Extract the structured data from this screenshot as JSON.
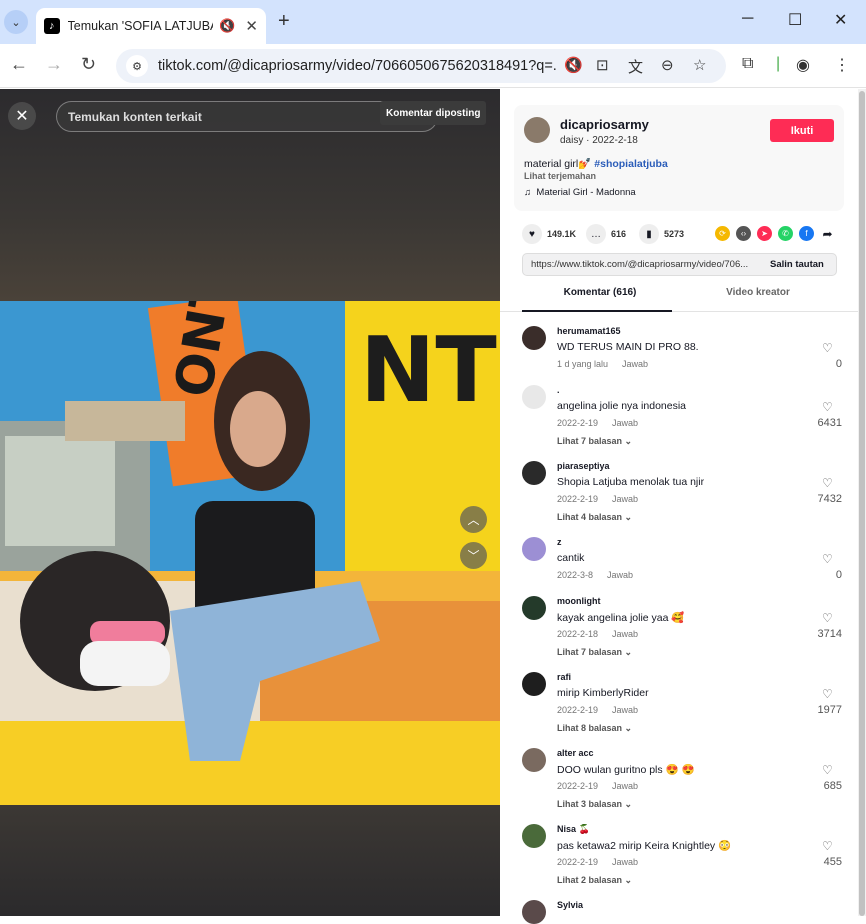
{
  "browser": {
    "tab_title": "Temukan 'SOFIA LATJUBA' di",
    "url": "tiktok.com/@dicapriosarmy/video/7066050675620318491?q=..."
  },
  "video": {
    "search_placeholder": "Temukan konten terkait",
    "tooltip": "Komentar diposting",
    "frame_text_left": "ONT",
    "frame_text_right": "NT"
  },
  "post": {
    "username": "dicapriosarmy",
    "nickname": "daisy",
    "date": "2022-2-18",
    "follow_label": "Ikuti",
    "caption": "material girl💅",
    "hashtag": "#shopialatjuba",
    "translate_label": "Lihat terjemahan",
    "music": "Material Girl - Madonna",
    "likes": "149.1K",
    "comments": "616",
    "saves": "5273",
    "link": "https://www.tiktok.com/@dicapriosarmy/video/706...",
    "copy_label": "Salin tautan"
  },
  "tabs": {
    "comments": "Komentar (616)",
    "creator": "Video kreator"
  },
  "comments": [
    {
      "user": "herumamat165",
      "text": "WD TERUS MAIN DI PRO 88.",
      "date": "1 d yang lalu",
      "reply": "Jawab",
      "likes": "0",
      "more": "",
      "avatar_color": "#3a2d2a"
    },
    {
      "user": ".",
      "text": "angelina jolie nya indonesia",
      "date": "2022-2-19",
      "reply": "Jawab",
      "likes": "6431",
      "more": "Lihat 7 balasan ⌄",
      "avatar_color": "#e8e8e8"
    },
    {
      "user": "piaraseptiya",
      "text": "Shopia Latjuba menolak tua njir",
      "date": "2022-2-19",
      "reply": "Jawab",
      "likes": "7432",
      "more": "Lihat 4 balasan ⌄",
      "avatar_color": "#2a2a2a"
    },
    {
      "user": "z",
      "text": "cantik",
      "date": "2022-3-8",
      "reply": "Jawab",
      "likes": "0",
      "more": "",
      "avatar_color": "#9c8fd4"
    },
    {
      "user": "moonlight",
      "text": "kayak angelina jolie yaa 🥰",
      "date": "2022-2-18",
      "reply": "Jawab",
      "likes": "3714",
      "more": "Lihat 7 balasan ⌄",
      "avatar_color": "#243a2a"
    },
    {
      "user": "rafi",
      "text": "mirip KimberlyRider",
      "date": "2022-2-19",
      "reply": "Jawab",
      "likes": "1977",
      "more": "Lihat 8 balasan ⌄",
      "avatar_color": "#1e1e1e"
    },
    {
      "user": "alter acc",
      "text": "DOO wulan guritno pls 😍 😍",
      "date": "2022-2-19",
      "reply": "Jawab",
      "likes": "685",
      "more": "Lihat 3 balasan ⌄",
      "avatar_color": "#7a6a60"
    },
    {
      "user": "Nisa 🍒",
      "text": "pas ketawa2 mirip Keira Knightley 😳",
      "date": "2022-2-19",
      "reply": "Jawab",
      "likes": "455",
      "more": "Lihat 2 balasan ⌄",
      "avatar_color": "#4a6a3a"
    },
    {
      "user": "Sylvia",
      "text": "",
      "date": "",
      "reply": "",
      "likes": "",
      "more": "",
      "avatar_color": "#5a4a4a"
    }
  ]
}
